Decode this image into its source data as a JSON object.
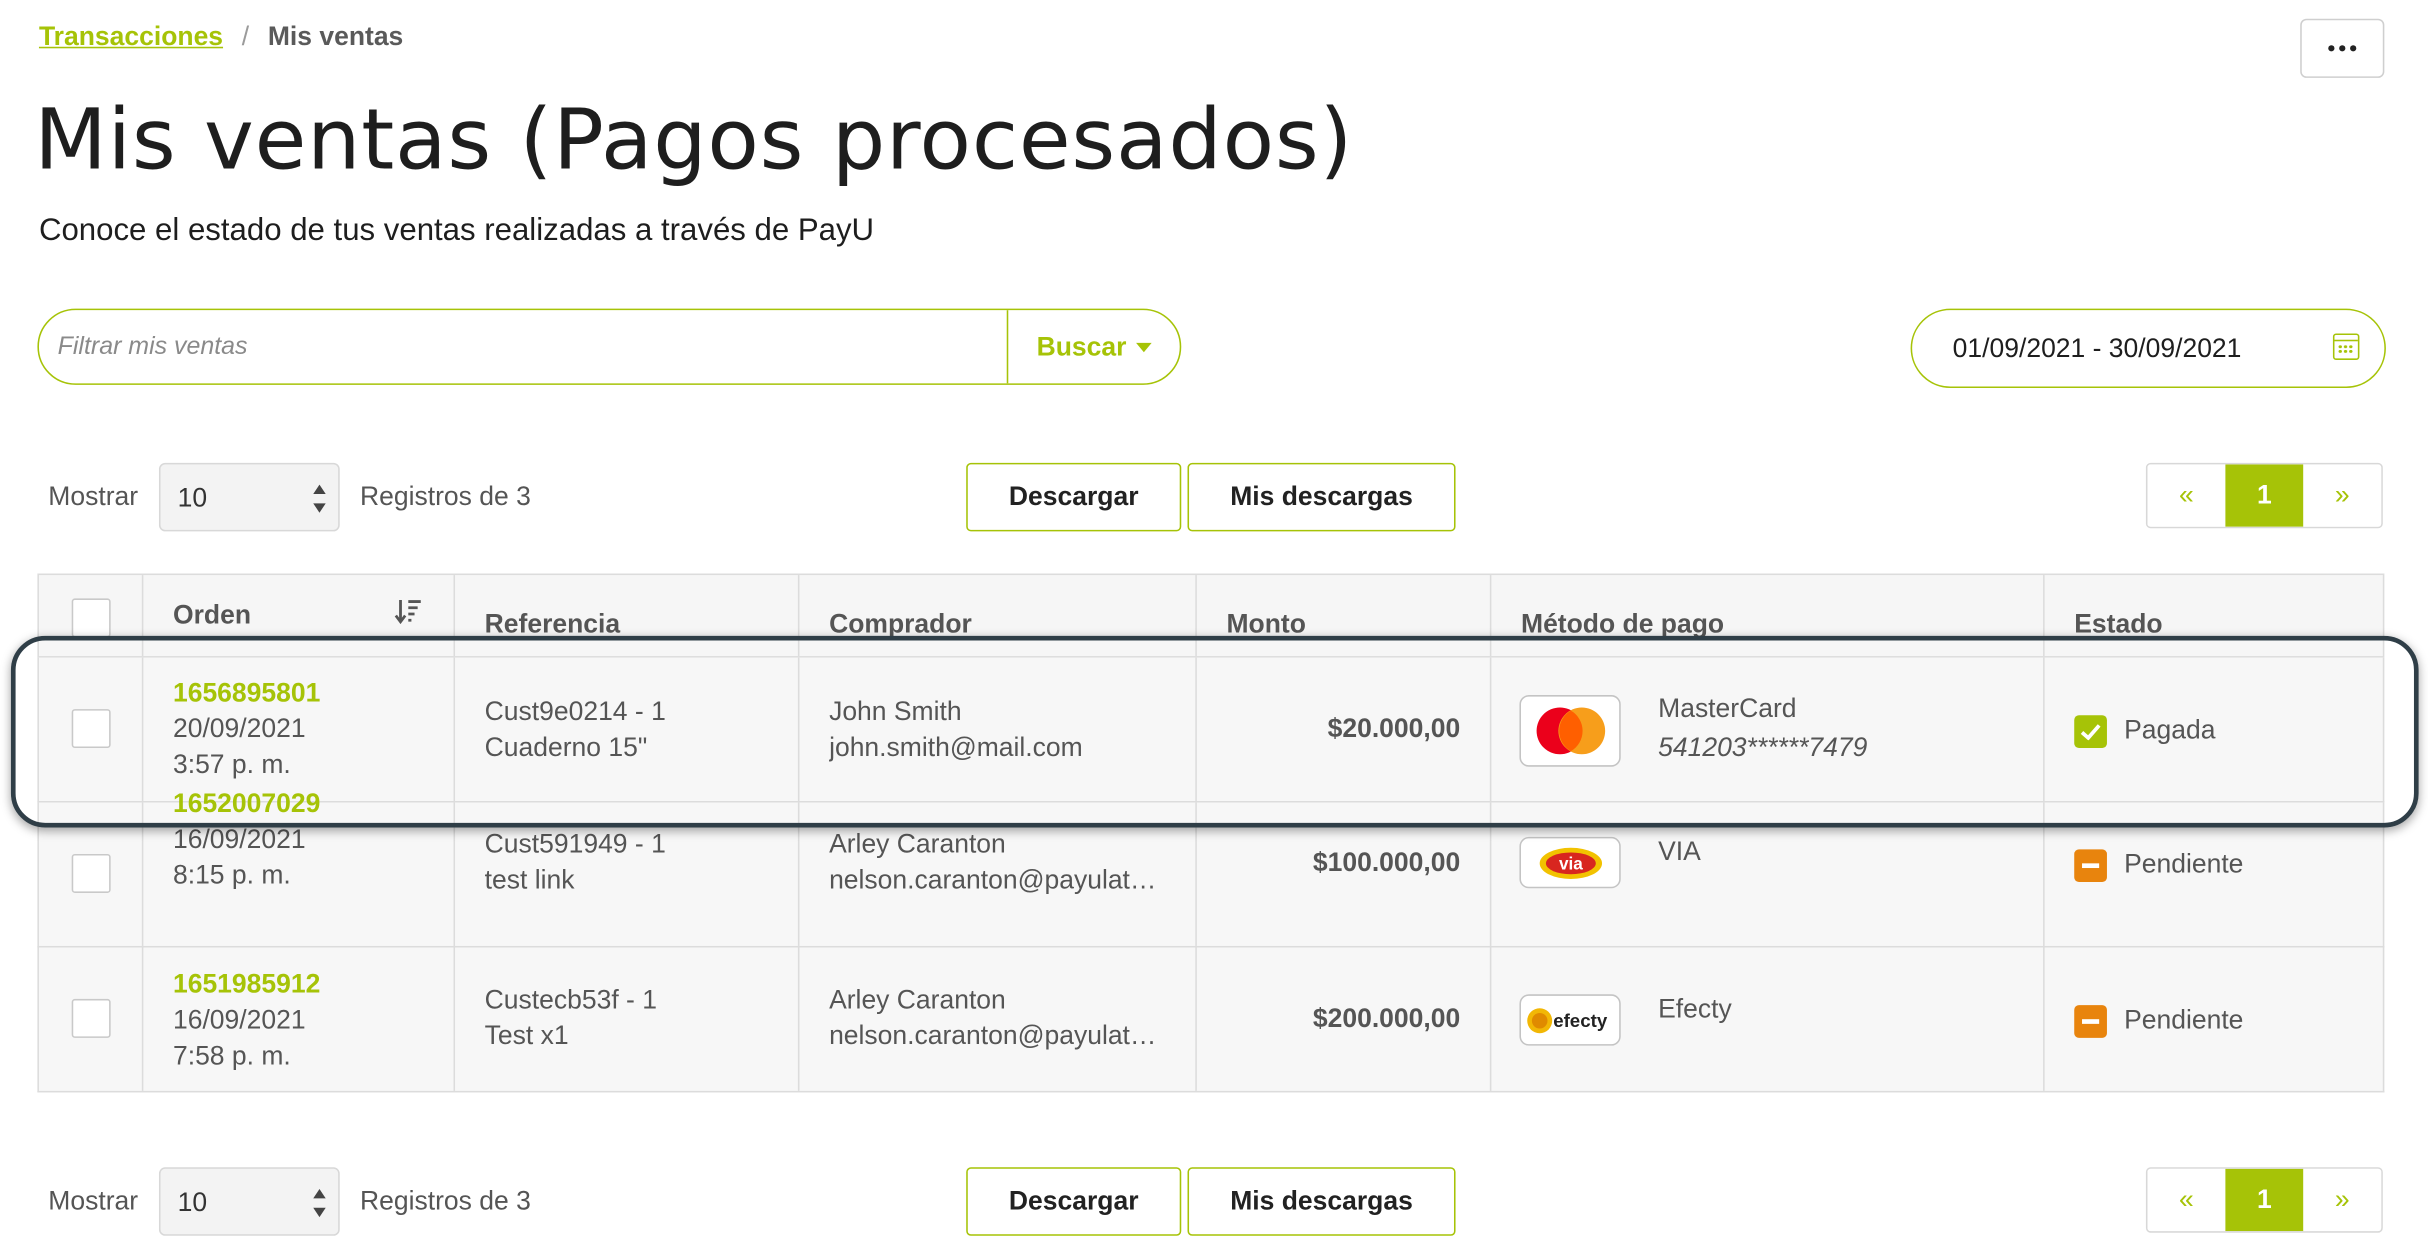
{
  "breadcrumb": {
    "parent": "Transacciones",
    "separator": "/",
    "current": "Mis ventas"
  },
  "header": {
    "title": "Mis ventas (Pagos procesados)",
    "subtitle": "Conoce el estado de tus ventas realizadas a través de PayU"
  },
  "search": {
    "placeholder": "Filtrar mis ventas",
    "value": "",
    "button_label": "Buscar"
  },
  "date_range": {
    "value": "01/09/2021 - 30/09/2021"
  },
  "toolbar": {
    "show_label": "Mostrar",
    "page_size": "10",
    "records_label": "Registros de 3",
    "download_label": "Descargar",
    "my_downloads_label": "Mis descargas",
    "pagination": {
      "prev": "«",
      "current": "1",
      "next": "»"
    }
  },
  "table": {
    "headers": {
      "order": "Orden",
      "reference": "Referencia",
      "buyer": "Comprador",
      "amount": "Monto",
      "payment_method": "Método de pago",
      "status": "Estado"
    },
    "rows": [
      {
        "order_id": "1656895801",
        "date": "20/09/2021",
        "time": "3:57 p. m.",
        "reference": "Cust9e0214 - 1",
        "description": "Cuaderno 15\"",
        "buyer_name": "John Smith",
        "buyer_email": "john.smith@mail.com",
        "amount": "$20.000,00",
        "method": "MasterCard",
        "card_number": "541203******7479",
        "method_icon": "mastercard-logo",
        "status": "Pagada"
      },
      {
        "order_id": "1652007029",
        "date": "16/09/2021",
        "time": "8:15 p. m.",
        "reference": "Cust591949 - 1",
        "description": "test link",
        "buyer_name": "Arley Caranton",
        "buyer_email": "nelson.caranton@payulata…",
        "amount": "$100.000,00",
        "method": "VIA",
        "card_number": "",
        "method_icon": "via-logo",
        "status": "Pendiente"
      },
      {
        "order_id": "1651985912",
        "date": "16/09/2021",
        "time": "7:58 p. m.",
        "reference": "Custecb53f - 1",
        "description": "Test x1",
        "buyer_name": "Arley Caranton",
        "buyer_email": "nelson.caranton@payulata…",
        "amount": "$200.000,00",
        "method": "Efecty",
        "card_number": "",
        "method_icon": "efecty-logo",
        "status": "Pendiente"
      }
    ]
  },
  "logos": {
    "via_text": "via",
    "efecty_text": "efecty"
  },
  "colors": {
    "accent": "#a6c307",
    "pending": "#e8840d",
    "highlight_border": "#2f3e47"
  }
}
